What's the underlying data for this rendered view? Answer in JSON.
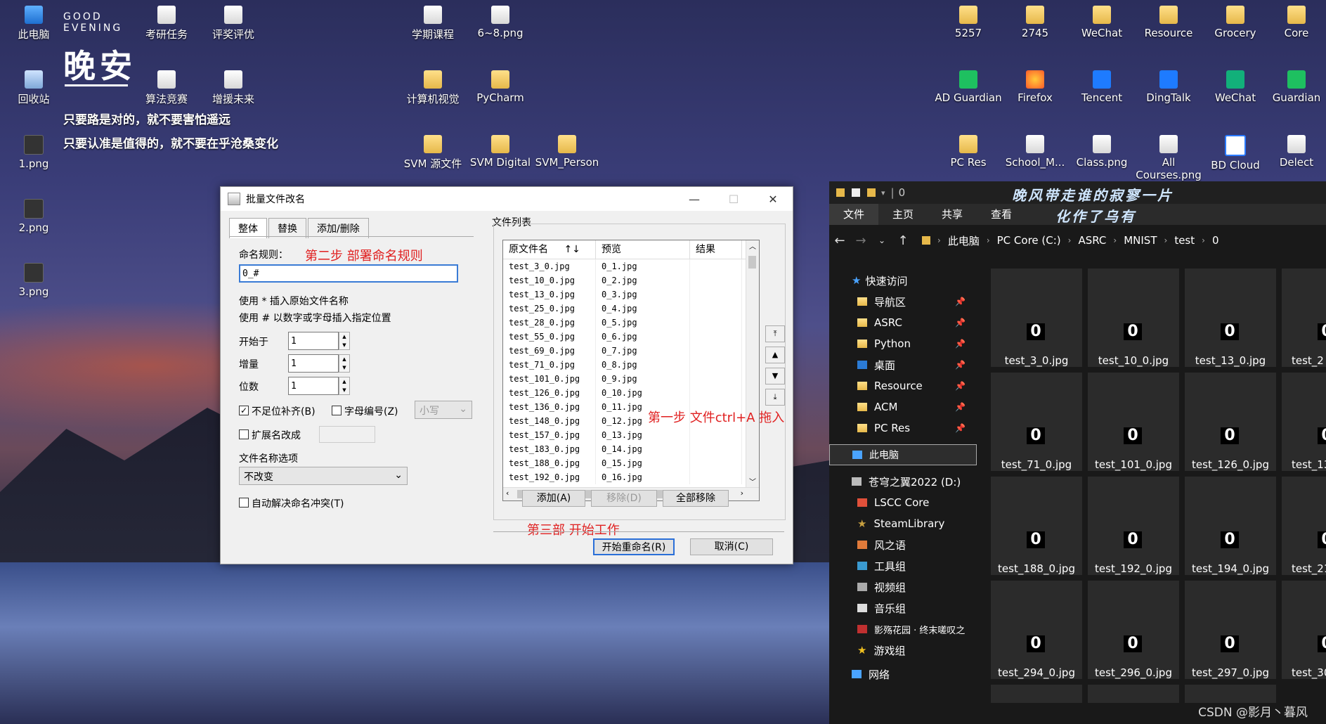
{
  "desktop": {
    "icons": [
      {
        "label": "此电脑",
        "kind": "pc"
      },
      {
        "label": "回收站",
        "kind": "bin"
      },
      {
        "label": "1.png",
        "kind": "dark"
      },
      {
        "label": "2.png",
        "kind": "dark"
      },
      {
        "label": "3.png",
        "kind": "dark"
      },
      {
        "label": "考研任务",
        "kind": "file"
      },
      {
        "label": "评奖评优",
        "kind": "file"
      },
      {
        "label": "算法竞赛",
        "kind": "file"
      },
      {
        "label": "增援未来",
        "kind": "file"
      },
      {
        "label": "学期课程",
        "kind": "file"
      },
      {
        "label": "6~8.png",
        "kind": "file"
      },
      {
        "label": "计算机视觉",
        "kind": "folder"
      },
      {
        "label": "PyCharm",
        "kind": "folder"
      },
      {
        "label": "SVM 源文件",
        "kind": "folder"
      },
      {
        "label": "SVM Digital",
        "kind": "folder"
      },
      {
        "label": "SVM_Person",
        "kind": "folder"
      },
      {
        "label": "5257",
        "kind": "folder"
      },
      {
        "label": "2745",
        "kind": "folder"
      },
      {
        "label": "WeChat",
        "kind": "folder"
      },
      {
        "label": "Resource",
        "kind": "folder"
      },
      {
        "label": "Grocery",
        "kind": "folder"
      },
      {
        "label": "Core",
        "kind": "folder"
      },
      {
        "label": "AD Guardian",
        "kind": "green"
      },
      {
        "label": "Firefox",
        "kind": "ffx"
      },
      {
        "label": "Tencent",
        "kind": "blue"
      },
      {
        "label": "DingTalk",
        "kind": "blue"
      },
      {
        "label": "WeChat",
        "kind": "teal"
      },
      {
        "label": "Guardian",
        "kind": "green"
      },
      {
        "label": "PC Res",
        "kind": "folder"
      },
      {
        "label": "School_M...",
        "kind": "file"
      },
      {
        "label": "Class.png",
        "kind": "file"
      },
      {
        "label": "All Courses.png",
        "kind": "file"
      },
      {
        "label": "BD Cloud",
        "kind": "bd"
      },
      {
        "label": "Delect",
        "kind": "file"
      }
    ],
    "widget": {
      "greeting_small_1": "GOOD",
      "greeting_small_2": "EVENING",
      "greeting_big": "晚安",
      "quote1": "只要路是对的，就不要害怕遥远",
      "quote2": "只要认准是值得的，就不要在乎沧桑变化"
    }
  },
  "dialog": {
    "title": "批量文件改名",
    "tabs": [
      "整体",
      "替换",
      "添加/删除"
    ],
    "rule_label": "命名规则：",
    "rule_value": "0_#",
    "annotation_step2": "第二步 部署命名规则",
    "hint1": "使用 * 插入原始文件名称",
    "hint2": "使用 # 以数字或字母插入指定位置",
    "start_label": "开始于",
    "start_value": "1",
    "step_label": "增量",
    "step_value": "1",
    "digits_label": "位数",
    "digits_value": "1",
    "pad_label": "不足位补齐(B)",
    "alpha_label": "字母编号(Z)",
    "case_value": "小写",
    "ext_label": "扩展名改成",
    "name_opt_label": "文件名称选项",
    "name_opt_value": "不改变",
    "auto_label": "自动解决命名冲突(T)",
    "list_group": "文件列表",
    "col_orig": "原文件名",
    "col_sort": "↑↓",
    "col_preview": "预览",
    "col_result": "结果",
    "files": [
      [
        "test_3_0.jpg",
        "0_1.jpg"
      ],
      [
        "test_10_0.jpg",
        "0_2.jpg"
      ],
      [
        "test_13_0.jpg",
        "0_3.jpg"
      ],
      [
        "test_25_0.jpg",
        "0_4.jpg"
      ],
      [
        "test_28_0.jpg",
        "0_5.jpg"
      ],
      [
        "test_55_0.jpg",
        "0_6.jpg"
      ],
      [
        "test_69_0.jpg",
        "0_7.jpg"
      ],
      [
        "test_71_0.jpg",
        "0_8.jpg"
      ],
      [
        "test_101_0.jpg",
        "0_9.jpg"
      ],
      [
        "test_126_0.jpg",
        "0_10.jpg"
      ],
      [
        "test_136_0.jpg",
        "0_11.jpg"
      ],
      [
        "test_148_0.jpg",
        "0_12.jpg"
      ],
      [
        "test_157_0.jpg",
        "0_13.jpg"
      ],
      [
        "test_183_0.jpg",
        "0_14.jpg"
      ],
      [
        "test_188_0.jpg",
        "0_15.jpg"
      ],
      [
        "test_192_0.jpg",
        "0_16.jpg"
      ]
    ],
    "annotation_step1": "第一步 文件ctrl+A 拖入",
    "add_btn": "添加(A)",
    "remove_btn": "移除(D)",
    "remove_all_btn": "全部移除",
    "annotation_step3": "第三部 开始工作",
    "start_btn": "开始重命名(R)",
    "cancel_btn": "取消(C)"
  },
  "explorer": {
    "top_count": "0",
    "deco1": "晚风带走谁的寂寥一片",
    "deco2": "化作了乌有",
    "ribbon": [
      "文件",
      "主页",
      "共享",
      "查看"
    ],
    "breadcrumb": [
      "此电脑",
      "PC Core (C:)",
      "ASRC",
      "MNIST",
      "test",
      "0"
    ],
    "quick_access": "快速访问",
    "quick_items": [
      "导航区",
      "ASRC",
      "Python",
      "桌面",
      "Resource",
      "ACM",
      "PC Res"
    ],
    "this_pc": "此电脑",
    "drives": [
      "苍穹之翼2022 (D:)",
      "LSCC Core",
      "SteamLibrary",
      "风之语",
      "工具组",
      "视频组",
      "音乐组",
      "影殇花园 · 终末嗟叹之",
      "游戏组"
    ],
    "network": "网络",
    "files": [
      [
        "test_3_0.jpg",
        "test_10_0.jpg",
        "test_13_0.jpg",
        "test_2"
      ],
      [
        "test_71_0.jpg",
        "test_101_0.jpg",
        "test_126_0.jpg",
        "test_13"
      ],
      [
        "test_188_0.jpg",
        "test_192_0.jpg",
        "test_194_0.jpg",
        "test_21"
      ],
      [
        "test_294_0.jpg",
        "test_296_0.jpg",
        "test_297_0.jpg",
        "test_30"
      ]
    ]
  },
  "watermark": "CSDN @影月丶暮风"
}
